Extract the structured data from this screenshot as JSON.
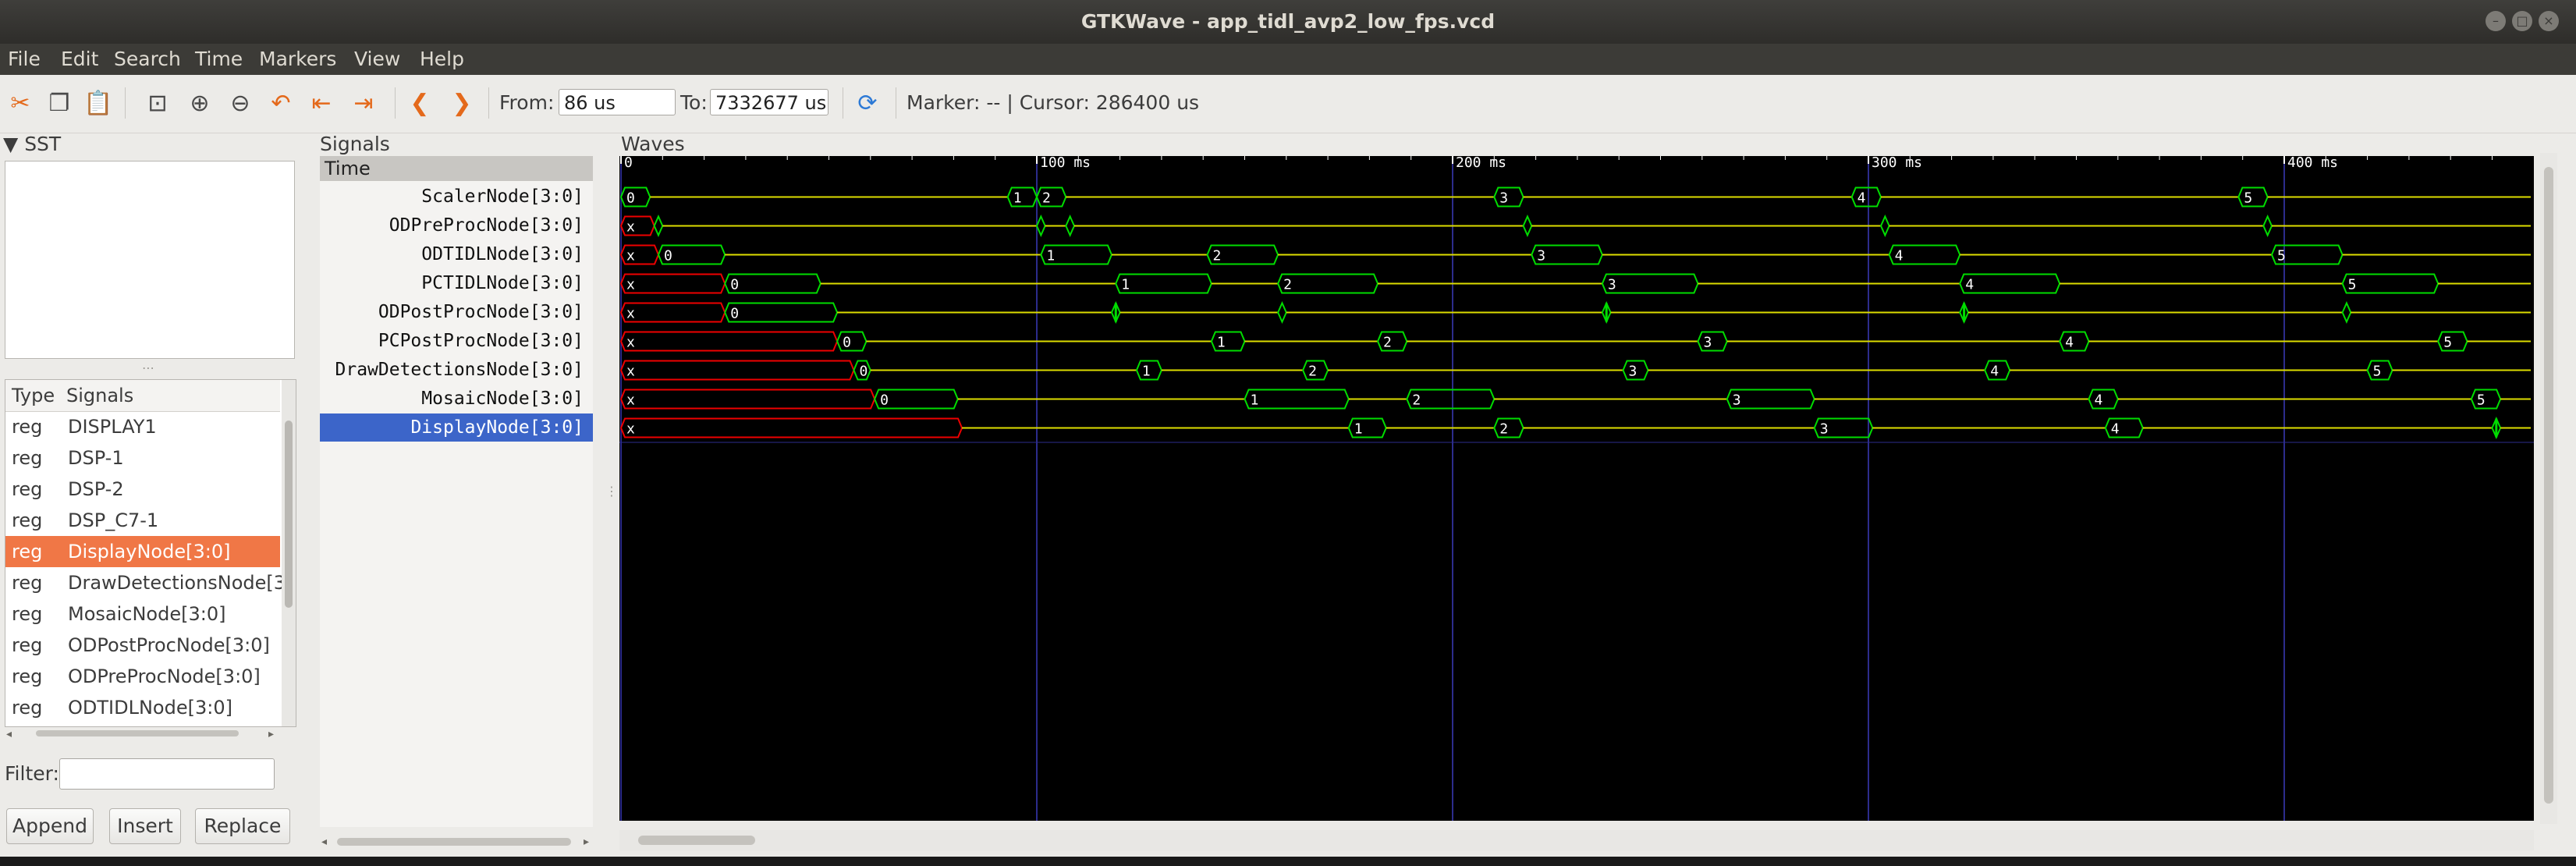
{
  "window": {
    "title": "GTKWave - app_tidl_avp2_low_fps.vcd",
    "menu": [
      "File",
      "Edit",
      "Search",
      "Time",
      "Markers",
      "View",
      "Help"
    ]
  },
  "toolbar": {
    "icons": [
      "cut-icon",
      "copy-icon",
      "paste-icon",
      "zoom-fit-icon",
      "zoom-in-icon",
      "zoom-out-icon",
      "undo-zoom-icon",
      "zoom-to-start-icon",
      "zoom-to-end-icon",
      "prev-edge-icon",
      "next-edge-icon",
      "reload-icon"
    ],
    "from_label": "From:",
    "from_value": "86 us",
    "to_label": "To:",
    "to_value": "7332677 us",
    "marker_text": "Marker: -- | Cursor: 286400 us"
  },
  "sst": {
    "header": "SST",
    "columns": {
      "type": "Type",
      "signals": "Signals"
    },
    "rows": [
      {
        "type": "reg",
        "name": "DISPLAY1"
      },
      {
        "type": "reg",
        "name": "DSP-1"
      },
      {
        "type": "reg",
        "name": "DSP-2"
      },
      {
        "type": "reg",
        "name": "DSP_C7-1"
      },
      {
        "type": "reg",
        "name": "DisplayNode[3:0]"
      },
      {
        "type": "reg",
        "name": "DrawDetectionsNode[3:0]"
      },
      {
        "type": "reg",
        "name": "MosaicNode[3:0]"
      },
      {
        "type": "reg",
        "name": "ODPostProcNode[3:0]"
      },
      {
        "type": "reg",
        "name": "ODPreProcNode[3:0]"
      },
      {
        "type": "reg",
        "name": "ODTIDLNode[3:0]"
      }
    ],
    "selected_index": 4,
    "filter_label": "Filter:",
    "filter_value": "",
    "buttons": {
      "append": "Append",
      "insert": "Insert",
      "replace": "Replace"
    }
  },
  "signals_pane": {
    "header": "Signals",
    "time_label": "Time",
    "names": [
      "ScalerNode[3:0]",
      "ODPreProcNode[3:0]",
      "ODTIDLNode[3:0]",
      "PCTIDLNode[3:0]",
      "ODPostProcNode[3:0]",
      "PCPostProcNode[3:0]",
      "DrawDetectionsNode[3:0]",
      "MosaicNode[3:0]",
      "DisplayNode[3:0]"
    ],
    "selected_index": 8
  },
  "waves": {
    "header": "Waves",
    "time_unit": "ms",
    "view_range_ms": [
      0,
      458
    ],
    "ticks": [
      {
        "t": 0,
        "label": "0"
      },
      {
        "t": 100,
        "label": "100 ms"
      },
      {
        "t": 200,
        "label": "200 ms"
      },
      {
        "t": 300,
        "label": "300 ms"
      },
      {
        "t": 400,
        "label": "400 ms"
      }
    ],
    "colors": {
      "bg": "#000000",
      "grid": "#2c2c8c",
      "value": "#00dd00",
      "idle": "#dddd00",
      "undef": "#ee0000",
      "text": "#ffffff",
      "tick": "#ffffff"
    },
    "signals": [
      {
        "name": "ScalerNode[3:0]",
        "initial": "0",
        "changes": [
          {
            "t": 0,
            "v": "0"
          },
          {
            "t": 7,
            "v": "_"
          },
          {
            "t": 93,
            "v": "1"
          },
          {
            "t": 100,
            "v": "2"
          },
          {
            "t": 107,
            "v": "_"
          },
          {
            "t": 210,
            "v": "3"
          },
          {
            "t": 217,
            "v": "_"
          },
          {
            "t": 296,
            "v": "4"
          },
          {
            "t": 303,
            "v": "_"
          },
          {
            "t": 389,
            "v": "5"
          },
          {
            "t": 396,
            "v": "_"
          }
        ]
      },
      {
        "name": "ODPreProcNode[3:0]",
        "initial": "x",
        "changes": [
          {
            "t": 0,
            "v": "x"
          },
          {
            "t": 8,
            "v": "g"
          },
          {
            "t": 10,
            "v": "_"
          },
          {
            "t": 100,
            "v": "g"
          },
          {
            "t": 102,
            "v": "_"
          },
          {
            "t": 107,
            "v": "g"
          },
          {
            "t": 109,
            "v": "_"
          },
          {
            "t": 217,
            "v": "g"
          },
          {
            "t": 219,
            "v": "_"
          },
          {
            "t": 303,
            "v": "g"
          },
          {
            "t": 305,
            "v": "_"
          },
          {
            "t": 395,
            "v": "g"
          },
          {
            "t": 397,
            "v": "_"
          }
        ]
      },
      {
        "name": "ODTIDLNode[3:0]",
        "initial": "x",
        "changes": [
          {
            "t": 0,
            "v": "x"
          },
          {
            "t": 9,
            "v": "0"
          },
          {
            "t": 25,
            "v": "_"
          },
          {
            "t": 101,
            "v": "1"
          },
          {
            "t": 118,
            "v": "_"
          },
          {
            "t": 141,
            "v": "2"
          },
          {
            "t": 158,
            "v": "_"
          },
          {
            "t": 219,
            "v": "3"
          },
          {
            "t": 236,
            "v": "_"
          },
          {
            "t": 305,
            "v": "4"
          },
          {
            "t": 322,
            "v": "_"
          },
          {
            "t": 397,
            "v": "5"
          },
          {
            "t": 414,
            "v": "_"
          }
        ]
      },
      {
        "name": "PCTIDLNode[3:0]",
        "initial": "x",
        "changes": [
          {
            "t": 0,
            "v": "x"
          },
          {
            "t": 25,
            "v": "0"
          },
          {
            "t": 48,
            "v": "_"
          },
          {
            "t": 119,
            "v": "1"
          },
          {
            "t": 142,
            "v": "_"
          },
          {
            "t": 158,
            "v": "2"
          },
          {
            "t": 182,
            "v": "_"
          },
          {
            "t": 236,
            "v": "3"
          },
          {
            "t": 259,
            "v": "_"
          },
          {
            "t": 322,
            "v": "4"
          },
          {
            "t": 346,
            "v": "_"
          },
          {
            "t": 414,
            "v": "5"
          },
          {
            "t": 437,
            "v": "_"
          }
        ]
      },
      {
        "name": "ODPostProcNode[3:0]",
        "initial": "x",
        "changes": [
          {
            "t": 0,
            "v": "x"
          },
          {
            "t": 25,
            "v": "0"
          },
          {
            "t": 52,
            "v": "_"
          },
          {
            "t": 118,
            "v": "p"
          },
          {
            "t": 120,
            "v": "_"
          },
          {
            "t": 158,
            "v": "g"
          },
          {
            "t": 160,
            "v": "_"
          },
          {
            "t": 236,
            "v": "p"
          },
          {
            "t": 238,
            "v": "_"
          },
          {
            "t": 322,
            "v": "p"
          },
          {
            "t": 324,
            "v": "_"
          },
          {
            "t": 414,
            "v": "g"
          },
          {
            "t": 416,
            "v": "_"
          }
        ]
      },
      {
        "name": "PCPostProcNode[3:0]",
        "initial": "x",
        "changes": [
          {
            "t": 0,
            "v": "x"
          },
          {
            "t": 52,
            "v": "0"
          },
          {
            "t": 59,
            "v": "_"
          },
          {
            "t": 142,
            "v": "1"
          },
          {
            "t": 150,
            "v": "_"
          },
          {
            "t": 182,
            "v": "2"
          },
          {
            "t": 189,
            "v": "_"
          },
          {
            "t": 259,
            "v": "3"
          },
          {
            "t": 266,
            "v": "_"
          },
          {
            "t": 346,
            "v": "4"
          },
          {
            "t": 353,
            "v": "_"
          },
          {
            "t": 437,
            "v": "5"
          },
          {
            "t": 444,
            "v": "_"
          }
        ]
      },
      {
        "name": "DrawDetectionsNode[3:0]",
        "initial": "x",
        "changes": [
          {
            "t": 0,
            "v": "x"
          },
          {
            "t": 56,
            "v": "0"
          },
          {
            "t": 60,
            "v": "_"
          },
          {
            "t": 124,
            "v": "1"
          },
          {
            "t": 130,
            "v": "_"
          },
          {
            "t": 164,
            "v": "2"
          },
          {
            "t": 170,
            "v": "_"
          },
          {
            "t": 241,
            "v": "3"
          },
          {
            "t": 247,
            "v": "_"
          },
          {
            "t": 328,
            "v": "4"
          },
          {
            "t": 334,
            "v": "_"
          },
          {
            "t": 420,
            "v": "5"
          },
          {
            "t": 426,
            "v": "_"
          }
        ]
      },
      {
        "name": "MosaicNode[3:0]",
        "initial": "x",
        "changes": [
          {
            "t": 0,
            "v": "x"
          },
          {
            "t": 61,
            "v": "0"
          },
          {
            "t": 81,
            "v": "_"
          },
          {
            "t": 150,
            "v": "1"
          },
          {
            "t": 175,
            "v": "_"
          },
          {
            "t": 189,
            "v": "2"
          },
          {
            "t": 210,
            "v": "_"
          },
          {
            "t": 266,
            "v": "3"
          },
          {
            "t": 287,
            "v": "_"
          },
          {
            "t": 353,
            "v": "4"
          },
          {
            "t": 360,
            "v": "_"
          },
          {
            "t": 445,
            "v": "5"
          },
          {
            "t": 452,
            "v": "_"
          }
        ]
      },
      {
        "name": "DisplayNode[3:0]",
        "initial": "x",
        "changes": [
          {
            "t": 0,
            "v": "x"
          },
          {
            "t": 82,
            "v": "_"
          },
          {
            "t": 175,
            "v": "1"
          },
          {
            "t": 184,
            "v": "_"
          },
          {
            "t": 210,
            "v": "2"
          },
          {
            "t": 217,
            "v": "_"
          },
          {
            "t": 287,
            "v": "3"
          },
          {
            "t": 301,
            "v": "_"
          },
          {
            "t": 357,
            "v": "4"
          },
          {
            "t": 366,
            "v": "_"
          },
          {
            "t": 450,
            "v": "p"
          },
          {
            "t": 452,
            "v": "_"
          }
        ]
      }
    ]
  }
}
